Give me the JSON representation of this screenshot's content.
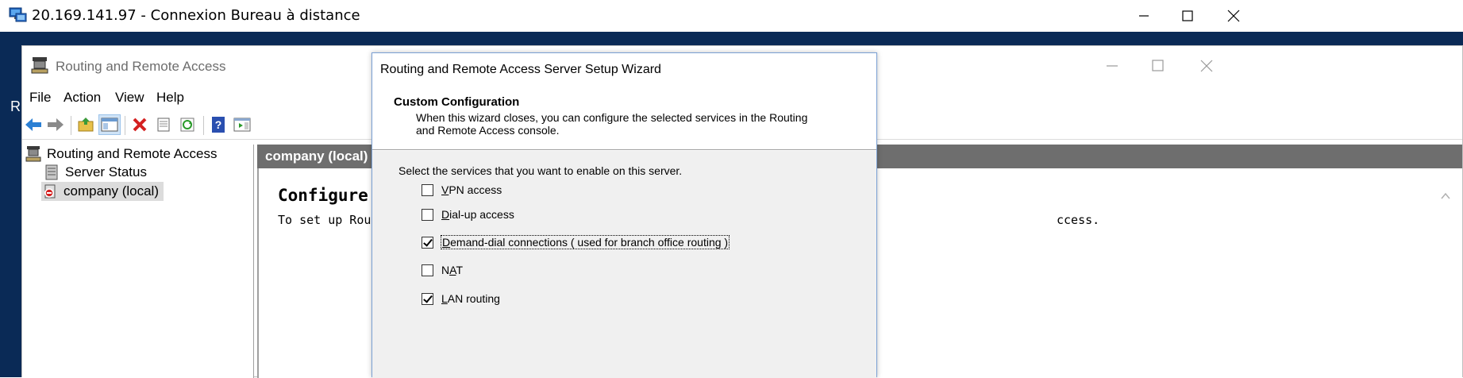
{
  "rdp": {
    "title": "20.169.141.97 - Connexion Bureau à distance",
    "controls": [
      "minimize",
      "maximize",
      "close"
    ]
  },
  "desktop": {
    "glyph": "R"
  },
  "mmc": {
    "title": "Routing and Remote Access",
    "menu": [
      "File",
      "Action",
      "View",
      "Help"
    ],
    "toolbar_icons": [
      "back-icon",
      "forward-icon",
      "up-folder-icon",
      "show-hide-console-tree-icon",
      "delete-icon",
      "properties-icon",
      "refresh-icon",
      "help-icon",
      "console-icon"
    ]
  },
  "tree": {
    "items": [
      {
        "label": "Routing and Remote Access",
        "icon": "rras-icon"
      },
      {
        "label": "Server Status",
        "icon": "server-status-icon"
      },
      {
        "label": "company (local)",
        "icon": "server-stopped-icon",
        "selected": true
      }
    ]
  },
  "content": {
    "header": "company (local)",
    "heading": "Configure the Ro",
    "text_left": "To set up Routing and R",
    "text_right": "ccess."
  },
  "wizard": {
    "title": "Routing and Remote Access Server Setup Wizard",
    "heading": "Custom Configuration",
    "description": "When this wizard closes, you can configure the selected services in the Routing and Remote Access console.",
    "prompt": "Select the services that you want to enable on this server.",
    "options": [
      {
        "pre": "",
        "accel": "V",
        "post": "PN access",
        "checked": false
      },
      {
        "pre": "",
        "accel": "D",
        "post": "ial-up access",
        "checked": false
      },
      {
        "pre": "",
        "accel": "D",
        "post": "emand-dial connections ( used for branch office routing )",
        "checked": true,
        "focused": true
      },
      {
        "pre": "N",
        "accel": "A",
        "post": "T",
        "checked": false
      },
      {
        "pre": "",
        "accel": "L",
        "post": "AN routing",
        "checked": true
      }
    ]
  },
  "colors": {
    "desktop": "#0a2a56",
    "content_header": "#6e6e6e",
    "wizard_body": "#f0f0f0",
    "wizard_border": "#7aa0d4"
  }
}
